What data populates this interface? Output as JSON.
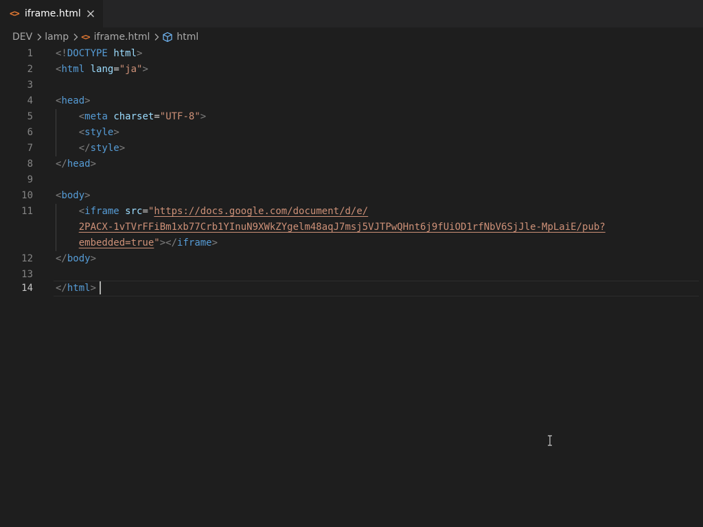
{
  "tab": {
    "icon": "html-file-icon",
    "label": "iframe.html",
    "close": "close-icon"
  },
  "breadcrumb": {
    "items": [
      "DEV",
      "lamp",
      "iframe.html",
      "html"
    ],
    "separator_icon": "chevron-right-icon",
    "file_icon": "html-file-icon",
    "symbol_icon": "cube-symbol-icon"
  },
  "editor": {
    "language": "html",
    "active_line": 14,
    "line_numbers": [
      "1",
      "2",
      "3",
      "4",
      "5",
      "6",
      "7",
      "8",
      "9",
      "10",
      "11",
      "12",
      "13",
      "14"
    ],
    "lines": [
      [
        [
          "<!",
          "bracket"
        ],
        [
          "DOCTYPE",
          "tag"
        ],
        [
          " ",
          "plain"
        ],
        [
          "html",
          "attr"
        ],
        [
          ">",
          "bracket"
        ]
      ],
      [
        [
          "<",
          "bracket"
        ],
        [
          "html",
          "tag"
        ],
        [
          " ",
          "plain"
        ],
        [
          "lang",
          "attr"
        ],
        [
          "=",
          "plain"
        ],
        [
          "\"ja\"",
          "str"
        ],
        [
          ">",
          "bracket"
        ]
      ],
      [],
      [
        [
          "<",
          "bracket"
        ],
        [
          "head",
          "tag"
        ],
        [
          ">",
          "bracket"
        ]
      ],
      [
        [
          "    ",
          "plain"
        ],
        [
          "<",
          "bracket"
        ],
        [
          "meta",
          "tag"
        ],
        [
          " ",
          "plain"
        ],
        [
          "charset",
          "attr"
        ],
        [
          "=",
          "plain"
        ],
        [
          "\"UTF-8\"",
          "str"
        ],
        [
          ">",
          "bracket"
        ]
      ],
      [
        [
          "    ",
          "plain"
        ],
        [
          "<",
          "bracket"
        ],
        [
          "style",
          "tag"
        ],
        [
          ">",
          "bracket"
        ]
      ],
      [
        [
          "    ",
          "plain"
        ],
        [
          "</",
          "bracket"
        ],
        [
          "style",
          "tag"
        ],
        [
          ">",
          "bracket"
        ]
      ],
      [
        [
          "</",
          "bracket"
        ],
        [
          "head",
          "tag"
        ],
        [
          ">",
          "bracket"
        ]
      ],
      [],
      [
        [
          "<",
          "bracket"
        ],
        [
          "body",
          "tag"
        ],
        [
          ">",
          "bracket"
        ]
      ],
      [
        [
          "    ",
          "plain"
        ],
        [
          "<",
          "bracket"
        ],
        [
          "iframe",
          "tag"
        ],
        [
          " ",
          "plain"
        ],
        [
          "src",
          "attr"
        ],
        [
          "=",
          "plain"
        ],
        [
          "\"",
          "str"
        ],
        [
          "https://docs.google.com/document/d/e/",
          "link"
        ]
      ],
      [
        [
          "    ",
          "plain"
        ],
        [
          "2PACX-1vTVrFFiBm1xb77Crb1YInuN9XWkZYgelm48aqJ7msj5VJTPwQHnt6j9fUiOD1rfNbV6SjJle-MpLaiE/pub?",
          "link"
        ]
      ],
      [
        [
          "    ",
          "plain"
        ],
        [
          "embedded=true",
          "link"
        ],
        [
          "\"",
          "str"
        ],
        [
          "></",
          "bracket"
        ],
        [
          "iframe",
          "tag"
        ],
        [
          ">",
          "bracket"
        ]
      ],
      [
        [
          "</",
          "bracket"
        ],
        [
          "body",
          "tag"
        ],
        [
          ">",
          "bracket"
        ]
      ],
      [],
      [
        [
          "</",
          "bracket"
        ],
        [
          "html",
          "tag"
        ],
        [
          ">",
          "bracket"
        ]
      ]
    ]
  },
  "colors": {
    "background": "#1e1e1e",
    "tag": "#569cd6",
    "attribute": "#9cdcfe",
    "string": "#ce9178",
    "bracket": "#808080",
    "line_number": "#858585",
    "file_icon": "#e37933"
  }
}
